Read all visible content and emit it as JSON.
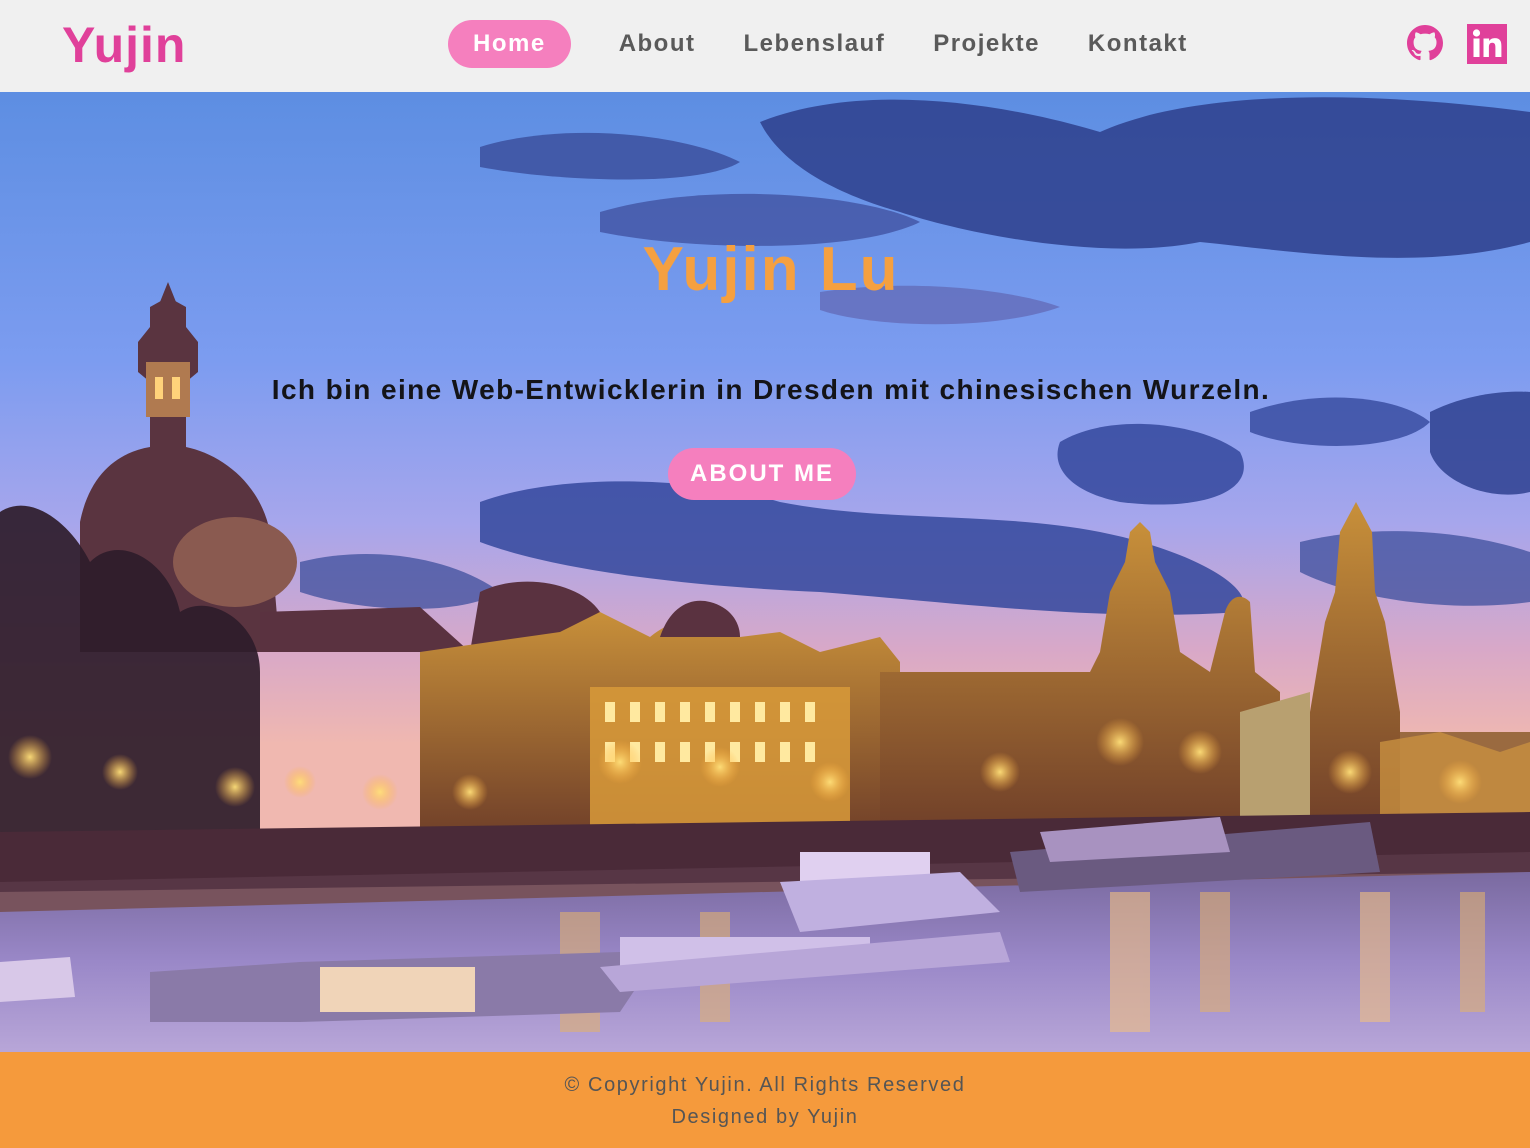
{
  "brand": {
    "logo": "Yujin"
  },
  "nav": {
    "items": [
      {
        "label": "Home",
        "active": true
      },
      {
        "label": "About",
        "active": false
      },
      {
        "label": "Lebenslauf",
        "active": false
      },
      {
        "label": "Projekte",
        "active": false
      },
      {
        "label": "Kontakt",
        "active": false
      }
    ]
  },
  "social": {
    "icons": [
      "github-icon",
      "linkedin-icon"
    ]
  },
  "hero": {
    "title": "Yujin Lu",
    "subtitle": "Ich bin eine Web-Entwicklerin in Dresden mit chinesischen Wurzeln.",
    "button_label": "ABOUT ME"
  },
  "footer": {
    "copyright": "© Copyright Yujin. All Rights Reserved",
    "designed_by": "Designed by Yujin"
  },
  "colors": {
    "accent_pink": "#e0409a",
    "button_pink": "#f57fbe",
    "title_orange": "#f5a040",
    "footer_orange": "#f59a3c",
    "header_bg": "#f0f0f0",
    "nav_text": "#5a5a5a"
  }
}
